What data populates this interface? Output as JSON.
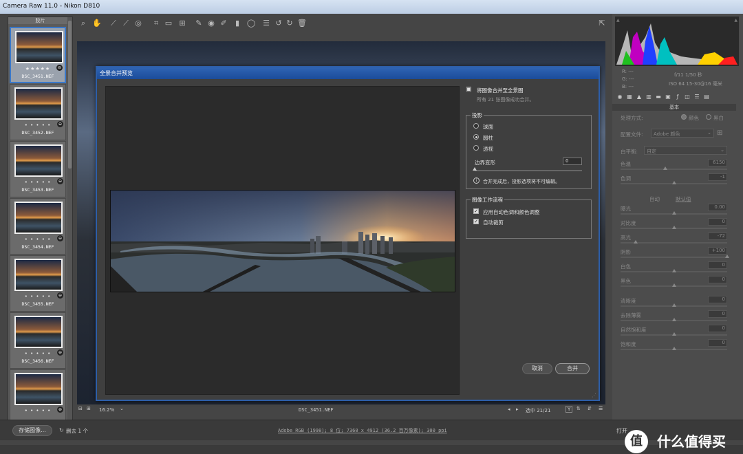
{
  "window": {
    "title": "Camera Raw 11.0 -  Nikon D810"
  },
  "filmstrip": {
    "header": "胶片",
    "items": [
      {
        "stars": "★★★★★",
        "name": "DSC_3451.NEF",
        "selected": true
      },
      {
        "stars": "• • • • •",
        "name": "DSC_3452.NEF",
        "selected": false
      },
      {
        "stars": "• • • • •",
        "name": "DSC_3453.NEF",
        "selected": false
      },
      {
        "stars": "• • • • •",
        "name": "DSC_3454.NEF",
        "selected": false
      },
      {
        "stars": "• • • • •",
        "name": "DSC_3455.NEF",
        "selected": false
      },
      {
        "stars": "• • • • •",
        "name": "DSC_3456.NEF",
        "selected": false
      },
      {
        "stars": "• • • • •",
        "name": "",
        "selected": false
      }
    ]
  },
  "preview": {
    "zoom": "16.2%",
    "filename": "DSC_3451.NEF",
    "selection": "选中 21/21"
  },
  "status": {
    "save_label": "存储图像...",
    "delete_label": "删去 1 个",
    "workflow_link": "Adobe RGB (1998); 8 位; 7360 x 4912 (36.2 百万像素); 300 ppi",
    "open_label": "打开"
  },
  "histogram": {
    "r": "R:  ---",
    "g": "G:  ---",
    "b": "B:  ---",
    "exposure": "f/11  1/50 秒",
    "iso": "ISO 64  15-30@16 毫米"
  },
  "basic": {
    "section": "基本",
    "treatment_label": "处理方式:",
    "color": "颜色",
    "bw": "黑白",
    "profile_label": "配置文件:",
    "profile_value": "Adobe 颜色",
    "wb_label": "白平衡:",
    "wb_value": "自定",
    "auto": "自动",
    "default": "默认值",
    "sliders1": [
      {
        "label": "色温",
        "value": "6150",
        "fraction": 0.42
      },
      {
        "label": "色调",
        "value": "-1",
        "fraction": 0.5
      }
    ],
    "sliders2": [
      {
        "label": "曝光",
        "value": "0.00",
        "fraction": 0.5
      },
      {
        "label": "对比度",
        "value": "0",
        "fraction": 0.5
      },
      {
        "label": "高光",
        "value": "-72",
        "fraction": 0.14
      },
      {
        "label": "阴影",
        "value": "+100",
        "fraction": 1.0
      },
      {
        "label": "白色",
        "value": "0",
        "fraction": 0.5
      },
      {
        "label": "黑色",
        "value": "0",
        "fraction": 0.5
      }
    ],
    "sliders3": [
      {
        "label": "清晰度",
        "value": "0",
        "fraction": 0.5
      },
      {
        "label": "去除薄雾",
        "value": "0",
        "fraction": 0.5
      },
      {
        "label": "自然饱和度",
        "value": "0",
        "fraction": 0.5
      },
      {
        "label": "饱和度",
        "value": "0",
        "fraction": 0.5
      }
    ]
  },
  "dialog": {
    "title": "全景合并预览",
    "heading": "将图像合并至全景图",
    "subheading": "所有 21 张图像成功合并。",
    "projection_group": "投影",
    "projection_options": [
      {
        "label": "球面",
        "selected": false
      },
      {
        "label": "圆柱",
        "selected": true
      },
      {
        "label": "透视",
        "selected": false
      }
    ],
    "boundary_label": "边界变形",
    "boundary_value": "0",
    "boundary_fraction": 0,
    "info_text": "合并完成后，投影选项将不可编辑。",
    "workflow_group": "图像工作流程",
    "checks": [
      {
        "label": "应用自动色调和颜色调整",
        "checked": true
      },
      {
        "label": "自动裁剪",
        "checked": true
      }
    ],
    "cancel_label": "取消",
    "merge_label": "合并"
  },
  "watermark": {
    "text": "什么值得买"
  },
  "colors": {
    "accent": "#2d5ea8",
    "panel": "#3f3f3f",
    "background": "#454545"
  }
}
